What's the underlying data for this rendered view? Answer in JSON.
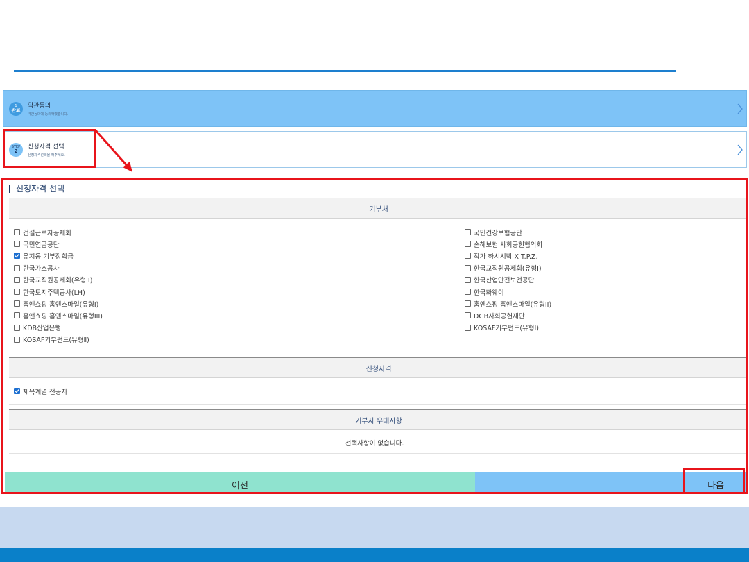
{
  "steps": [
    {
      "badge_top": "1",
      "badge_bottom": "완료",
      "title": "약관동의",
      "subtitle": "약관동의에 동의하였습니다."
    },
    {
      "badge_top": "STEP",
      "badge_bottom": "2",
      "title": "신청자격 선택",
      "subtitle": "신청자격선택을 해주세요."
    }
  ],
  "section_title": "신청자격 선택",
  "donors": {
    "header": "기부처",
    "left": [
      {
        "label": "건설근로자공제회",
        "checked": false
      },
      {
        "label": "국민연금공단",
        "checked": false
      },
      {
        "label": "유지웅 기부장학금",
        "checked": true
      },
      {
        "label": "한국가스공사",
        "checked": false
      },
      {
        "label": "한국교직원공제회(유형II)",
        "checked": false
      },
      {
        "label": "한국토지주택공사(LH)",
        "checked": false
      },
      {
        "label": "홈앤쇼핑 홈앤스마일(유형I)",
        "checked": false
      },
      {
        "label": "홈앤쇼핑 홈앤스마일(유형III)",
        "checked": false
      },
      {
        "label": "KDB산업은행",
        "checked": false
      },
      {
        "label": "KOSAF기부펀드(유형Ⅱ)",
        "checked": false
      }
    ],
    "right": [
      {
        "label": "국민건강보험공단",
        "checked": false
      },
      {
        "label": "손해보험 사회공헌협의회",
        "checked": false
      },
      {
        "label": "작가 하시시박 X T.P.Z.",
        "checked": false
      },
      {
        "label": "한국교직원공제회(유형I)",
        "checked": false
      },
      {
        "label": "한국산업안전보건공단",
        "checked": false
      },
      {
        "label": "한국화웨이",
        "checked": false
      },
      {
        "label": "홈앤쇼핑 홈앤스마일(유형II)",
        "checked": false
      },
      {
        "label": "DGB사회공헌재단",
        "checked": false
      },
      {
        "label": "KOSAF기부펀드(유형Ⅰ)",
        "checked": false
      }
    ]
  },
  "qualification": {
    "header": "신청자격",
    "items": [
      {
        "label": "체육계열 전공자",
        "checked": true
      }
    ]
  },
  "benefits": {
    "header": "기부자 우대사항",
    "empty_text": "선택사항이 없습니다."
  },
  "buttons": {
    "prev": "이전",
    "next": "다음"
  },
  "colors": {
    "accent_blue": "#1d7fcf",
    "step_done": "#7ec3f7",
    "prev_button": "#8fe3cf",
    "highlight": "#e8141b",
    "footer": "#0a80c9"
  },
  "icons": {
    "step_chevron": "chevron-right-icon",
    "checkbox_check": "check-icon"
  }
}
